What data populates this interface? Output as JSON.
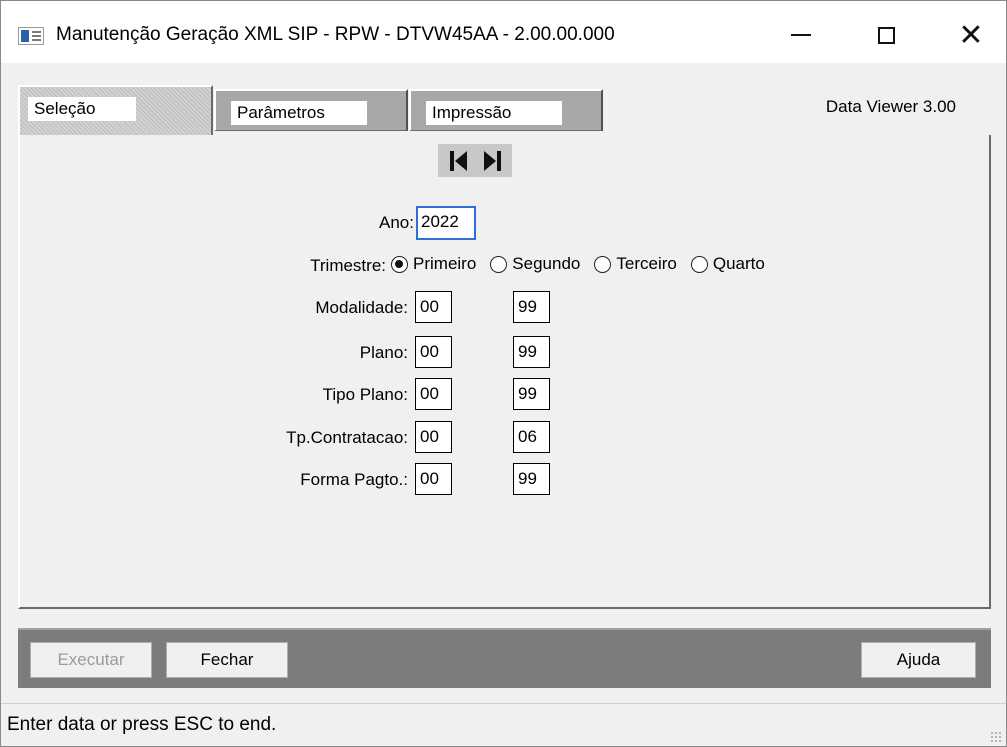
{
  "window": {
    "title": "Manutenção Geração XML SIP - RPW - DTVW45AA - 2.00.00.000",
    "minimize": "—",
    "maximize": "☐",
    "close": "✕"
  },
  "tabs": [
    {
      "label": "Seleção",
      "active": true
    },
    {
      "label": "Parâmetros",
      "active": false
    },
    {
      "label": "Impressão",
      "active": false
    }
  ],
  "data_viewer": "Data Viewer 3.00",
  "form": {
    "ano_label": "Ano:",
    "ano_value": "2022",
    "trimestre_label": "Trimestre:",
    "trimestre_options": [
      "Primeiro",
      "Segundo",
      "Terceiro",
      "Quarto"
    ],
    "trimestre_selected": "Primeiro",
    "rows": [
      {
        "label": "Modalidade:",
        "from": "00",
        "to": "99"
      },
      {
        "label": "Plano:",
        "from": "00",
        "to": "99"
      },
      {
        "label": "Tipo Plano:",
        "from": "00",
        "to": "99"
      },
      {
        "label": "Tp.Contratacao:",
        "from": "00",
        "to": "06"
      },
      {
        "label": "Forma Pagto.:",
        "from": "00",
        "to": "99"
      }
    ]
  },
  "buttons": {
    "executar": "Executar",
    "fechar": "Fechar",
    "ajuda": "Ajuda"
  },
  "status": "Enter data or press ESC to end."
}
